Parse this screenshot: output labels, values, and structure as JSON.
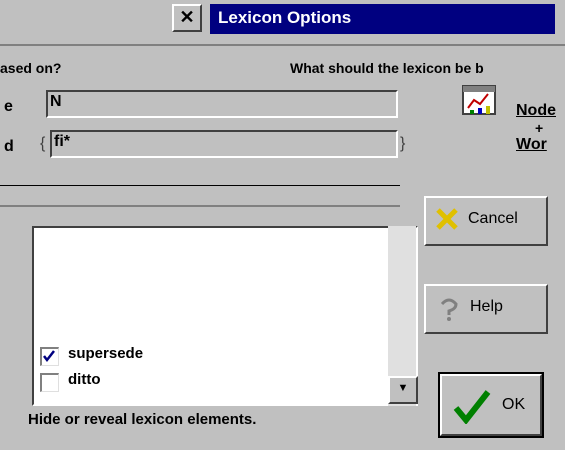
{
  "window": {
    "title": "Lexicon Options"
  },
  "question": {
    "left": "ased on?",
    "right": "What should the lexicon be b"
  },
  "fields": [
    {
      "label": "e",
      "value": "N"
    },
    {
      "label": "d",
      "value": "fi*"
    }
  ],
  "tree_button": {
    "line1": "Node",
    "line2": "+",
    "line3": "Wor"
  },
  "list": {
    "items": [
      {
        "label": "supersede",
        "checked": true
      },
      {
        "label": "ditto",
        "checked": false
      }
    ]
  },
  "buttons": {
    "cancel": "Cancel",
    "help": "Help",
    "ok": "OK"
  },
  "status": "Hide or reveal lexicon elements."
}
